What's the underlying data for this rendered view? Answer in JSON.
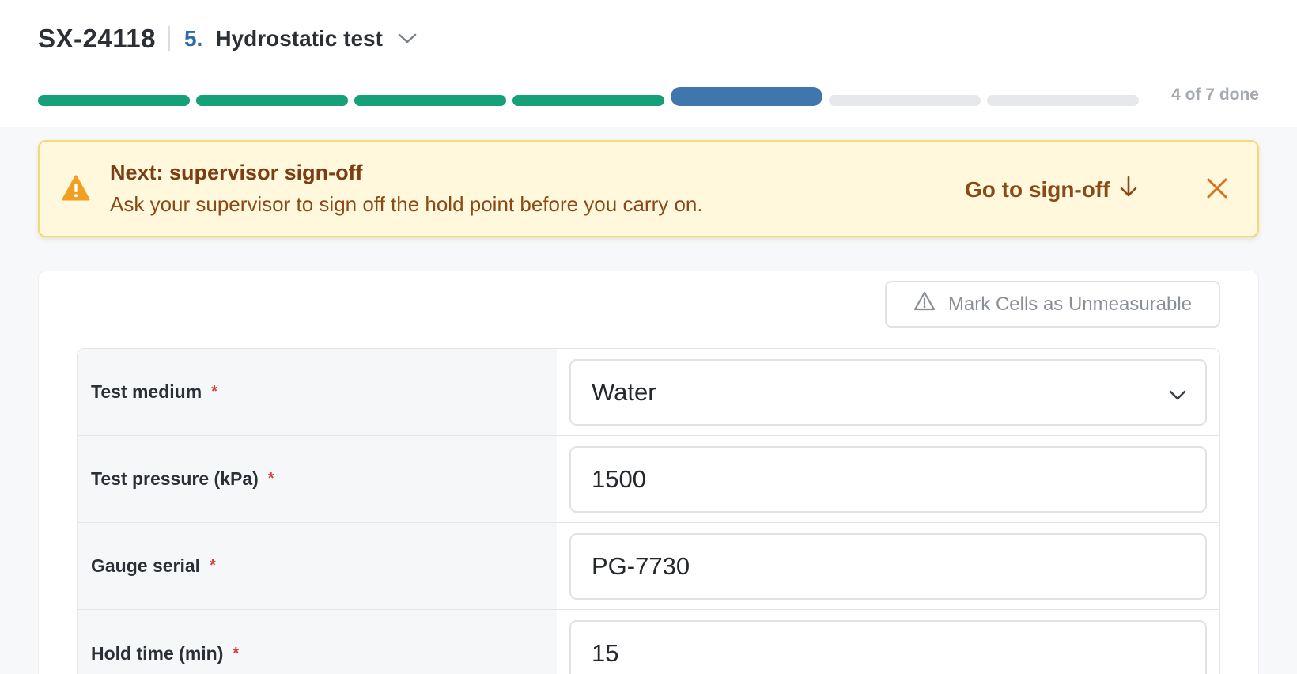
{
  "header": {
    "job_id": "SX-24118",
    "step_number": "5.",
    "step_name": "Hydrostatic test",
    "step_menu_icon": "chevron-down-icon"
  },
  "progress": {
    "done": 4,
    "total": 7,
    "current_step": 5,
    "label": "4 of 7 done",
    "colors": {
      "done": "#16a07a",
      "current": "#3f76ad",
      "pending": "#e6e8eb"
    }
  },
  "banner": {
    "icon": "warning-icon",
    "title": "Next: supervisor sign-off",
    "message": "Ask your supervisor to sign off the hold point before you carry on.",
    "action_label": "Go to sign-off",
    "action_icon": "arrow-down-icon",
    "close_icon": "close-icon",
    "colors": {
      "background": "#fff8dd",
      "border": "#f3d977",
      "text": "#8a4a15",
      "icon": "#f0a020"
    }
  },
  "toolbar": {
    "mark_unmeasurable_label": "Mark Cells as Unmeasurable",
    "mark_unmeasurable_icon": "warning-outline-icon"
  },
  "form": {
    "required_marker": "*",
    "fields": [
      {
        "label": "Test medium",
        "value": "Water",
        "type": "select",
        "required": true
      },
      {
        "label": "Test pressure (kPa)",
        "value": "1500",
        "type": "text",
        "required": true
      },
      {
        "label": "Gauge serial",
        "value": "PG-7730",
        "type": "text",
        "required": true
      },
      {
        "label": "Hold time (min)",
        "value": "15",
        "type": "text",
        "required": true
      }
    ]
  }
}
